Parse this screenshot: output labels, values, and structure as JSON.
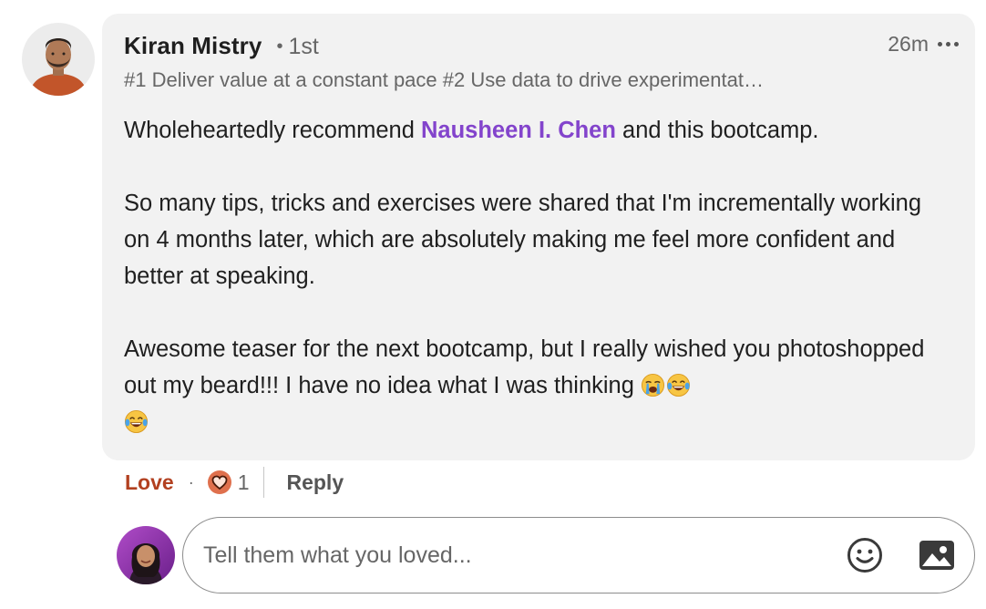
{
  "comment": {
    "author": {
      "name": "Kiran Mistry",
      "degree": "1st",
      "headline": "#1 Deliver value at a constant pace #2 Use data to drive experimentat…"
    },
    "timestamp": "26m",
    "body": {
      "p1_before": "Wholeheartedly recommend ",
      "mention": "Nausheen I. Chen",
      "p1_after": " and this bootcamp.",
      "p2": "So many tips, tricks and exercises were shared that I'm incrementally working on 4 months later, which are absolutely making me feel more confident and better at speaking.",
      "p3": "Awesome teaser for the next bootcamp, but I really wished you photoshopped out my beard!!! I have no idea what I was thinking ",
      "emojis": [
        "loudly-crying-face",
        "tears-of-joy-face",
        "tears-of-joy-face"
      ]
    }
  },
  "actions": {
    "reaction_label": "Love",
    "separator": "·",
    "reaction_icon": "heart-reaction-icon",
    "reaction_count": "1",
    "reply_label": "Reply"
  },
  "reply_box": {
    "placeholder": "Tell them what you loved..."
  },
  "colors": {
    "mention": "#8344cc",
    "love": "#b24020",
    "bubble": "#f2f2f2",
    "muted_text": "#666666"
  }
}
